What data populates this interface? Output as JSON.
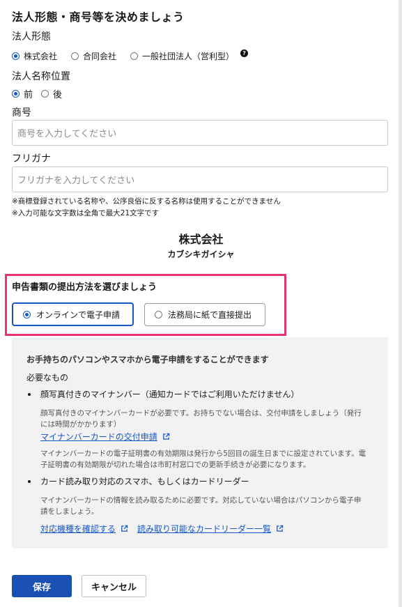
{
  "section1": {
    "title": "法人形態・商号等を決めましょう",
    "entity_type_label": "法人形態",
    "entity_options": [
      "株式会社",
      "合同会社",
      "一般社団法人（営利型）"
    ],
    "entity_selected_index": 0,
    "help_glyph": "?",
    "name_position_label": "法人名称位置",
    "position_options": [
      "前",
      "後"
    ],
    "position_selected_index": 0,
    "trade_name_label": "商号",
    "trade_name_placeholder": "商号を入力してください",
    "trade_name_value": "",
    "furigana_label": "フリガナ",
    "furigana_placeholder": "フリガナを入力してください",
    "furigana_value": "",
    "notes": [
      "※商標登録されている名称や、公序良俗に反する名称は使用することができません",
      "※入力可能な文字数は全角で最大21文字です"
    ],
    "preview_name": "株式会社",
    "preview_kana": "カブシキガイシャ"
  },
  "section2": {
    "title": "申告書類の提出方法を選びましょう",
    "methods": [
      "オンラインで電子申請",
      "法務局に紙で直接提出"
    ],
    "method_selected_index": 0
  },
  "info_panel": {
    "heading": "お手持ちのパソコンやスマホから電子申請をすることができます",
    "required_label": "必要なもの",
    "item1_title": "顔写真付きのマイナンバー（通知カードではご利用いただけません）",
    "item1_desc_line1": "顔写真付きのマイナンバーカードが必要です。お持ちでない場合は、交付申請をしましょう（発行",
    "item1_desc_line2": "には時間がかかります）",
    "item1_link": "マイナンバーカードの交付申請",
    "item1_note_line1": "マイナンバーカードの電子証明書の有効期限は発行から5回目の誕生日までに設定されています。電",
    "item1_note_line2": "子証明書の有効期限が切れた場合は市町村窓口での更新手続きが必要になります。",
    "item2_title": "カード読み取り対応のスマホ、もしくはカードリーダー",
    "item2_desc_line1": "マイナンバーカードの情報を読み取るために必要です。対応していない場合はパソコンから電子申",
    "item2_desc_line2": "請をしましょう。",
    "link_devices": "対応機種を確認する",
    "link_readers": "読み取り可能なカードリーダー一覧"
  },
  "actions": {
    "save": "保存",
    "cancel": "キャンセル"
  },
  "colors": {
    "accent": "#1657c8",
    "highlight_border": "#e8336d",
    "panel_bg": "#f2f2f2",
    "primary_button": "#1a4fb4"
  },
  "icons": {
    "help": "question-circle-icon",
    "external": "external-link-icon"
  }
}
